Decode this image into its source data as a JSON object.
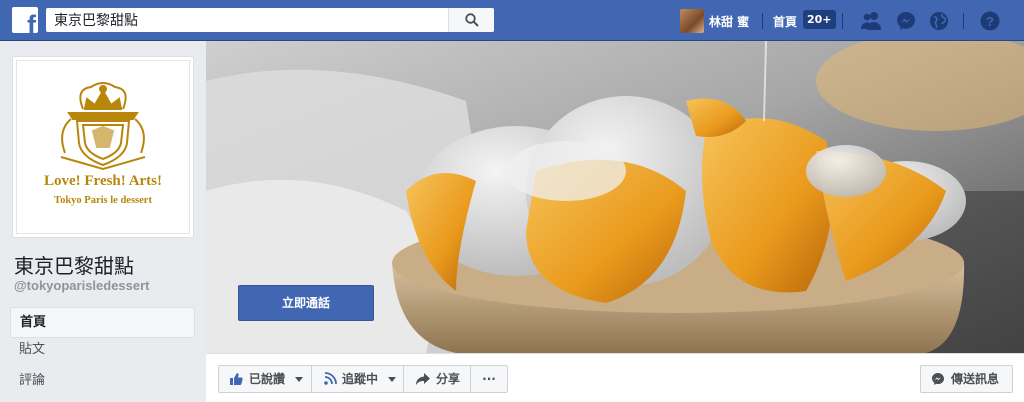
{
  "topbar": {
    "logo_letter": "f",
    "search": {
      "value": "東京巴黎甜點",
      "placeholder": ""
    },
    "search_icon": "search-icon",
    "profile_name": "林甜 蜜",
    "home_label": "首頁",
    "notification_badge": "20+",
    "icons": [
      "friends-icon",
      "messenger-icon",
      "globe-icon",
      "help-icon"
    ]
  },
  "page": {
    "logo_text": "Love! Fresh! Arts!",
    "logo_subtext": "Tokyo Paris le dessert",
    "name": "東京巴黎甜點",
    "handle": "@tokyoparisledessert"
  },
  "nav": {
    "items": [
      {
        "label": "首頁"
      },
      {
        "label": "貼文"
      },
      {
        "label": "評論"
      }
    ]
  },
  "cover": {
    "cta_label": "立即通話"
  },
  "actions": {
    "like_label": "已說讚",
    "follow_label": "追蹤中",
    "share_label": "分享",
    "more_label": "···",
    "message_label": "傳送訊息"
  },
  "colors": {
    "brand_blue": "#4267b2",
    "logo_gold": "#b8860b",
    "page_bg": "#e9ebee"
  }
}
